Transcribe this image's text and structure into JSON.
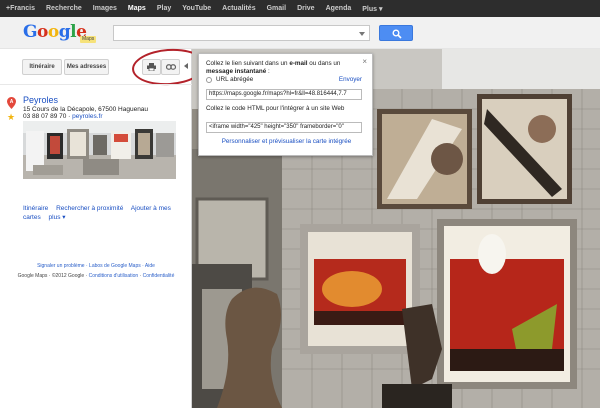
{
  "topnav": {
    "items": [
      "+Francis",
      "Recherche",
      "Images",
      "Maps",
      "Play",
      "YouTube",
      "Actualités",
      "Gmail",
      "Drive",
      "Agenda",
      "Plus ▾"
    ],
    "active_index": 3
  },
  "header": {
    "logo_letters": [
      "G",
      "o",
      "o",
      "g",
      "l",
      "e"
    ],
    "logo_badge": "Maps"
  },
  "toolbar": {
    "itineraire_label": "Itinéraire",
    "mes_adresses_label": "Mes adresses"
  },
  "place": {
    "name": "Peyroles",
    "address": "15 Cours de la Décapole, 67500 Haguenau",
    "phone": "03 88 07 89 70",
    "separator": " · ",
    "website": "peyroles.fr"
  },
  "actions": {
    "itineraire": "Itinéraire",
    "nearby": "Rechercher à proximité",
    "add": "Ajouter à mes cartes",
    "more": "plus ▾"
  },
  "footer": {
    "report": "Signaler un problème",
    "labs": "Labos de Google Maps",
    "help": "Aide",
    "dot": " · ",
    "copyright": "Google Maps · ©2012 Google · ",
    "terms": "Conditions d'utilisation",
    "privacy": "Confidentialité"
  },
  "share_popup": {
    "intro_before": "Collez le lien suivant dans un ",
    "intro_email": "e-mail",
    "intro_middle": " ou dans un ",
    "intro_im": "message instantané",
    "intro_after": " :",
    "short_url_label": "URL abrégée",
    "send_label": "Envoyer",
    "link_value": "https://maps.google.fr/maps?hl=fr&ll=48.816444,7.7",
    "embed_instruction": "Collez le code HTML pour l'intégrer à un site Web",
    "embed_value": "<iframe width=\"425\" height=\"350\" frameborder=\"0\"",
    "customize_label": "Personnaliser et prévisualiser la carte intégrée",
    "close_glyph": "×"
  },
  "colors": {
    "logo_blue": "#2a6ee8",
    "logo_red": "#d6311c",
    "logo_yellow": "#f2b50f",
    "logo_green": "#2ea34a",
    "search_button": "#4d8df3",
    "link_blue": "#1a4fc2",
    "highlight_circle": "#b3222a"
  },
  "icons": {
    "search": "search-icon",
    "print": "printer-icon",
    "link": "link-icon",
    "collapse": "collapse-panel-icon",
    "marker": "map-marker-icon",
    "star": "star-icon",
    "close": "close-icon"
  }
}
